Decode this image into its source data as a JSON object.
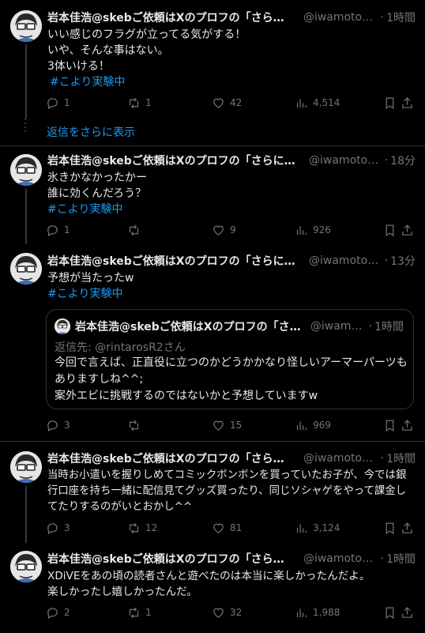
{
  "author": {
    "name": "岩本佳浩@skebご依頼はXのプロフの「さらに…",
    "name_long": "岩本佳浩@skebご依頼はXのプロフの「さらに表…",
    "handle": "@iwamoto_…",
    "handle_long": "@iwamoto_…",
    "dot": "·"
  },
  "tweets": [
    {
      "time": "1時間",
      "lines": [
        "いい感じのフラグが立ってる気がする！",
        "いや、そんな事はない。",
        "3体いける！"
      ],
      "hashtag": "#こより実験中",
      "stats": {
        "reply": "1",
        "retweet": "1",
        "like": "42",
        "views": "4,514"
      }
    },
    {
      "time": "18分",
      "lines": [
        "氷きかなかったかー",
        "誰に効くんだろう？"
      ],
      "hashtag": "#こより実験中",
      "stats": {
        "reply": "1",
        "retweet": "",
        "like": "9",
        "views": "926"
      }
    },
    {
      "time": "13分",
      "lines": [
        "予想が当たったw"
      ],
      "hashtag": "#こより実験中",
      "stats": {
        "reply": "3",
        "retweet": "",
        "like": "15",
        "views": "969"
      }
    },
    {
      "time": "1時間",
      "lines": [
        "当時お小遣いを握りしめてコミックボンボンを買っていたお子が、今では銀",
        "行口座を持ち一緒に配信見てグッズ買ったり、同じソシャゲをやって課金し",
        "てたりするのがいとおかし^^"
      ],
      "stats": {
        "reply": "3",
        "retweet": "12",
        "like": "81",
        "views": "3,124"
      }
    },
    {
      "time": "1時間",
      "lines": [
        "XDiVEをあの頃の読者さんと遊べたのは本当に楽しかったんだよ。",
        "楽しかったし嬉しかったんだ。"
      ],
      "stats": {
        "reply": "2",
        "retweet": "1",
        "like": "32",
        "views": "1,988"
      }
    }
  ],
  "show_more": "返信をさらに表示",
  "quote": {
    "name": "岩本佳浩@skebご依頼はXのプロフの「さら…",
    "handle": "@iwamo…",
    "time": "1時間",
    "reply_to_label": "返信先: ",
    "reply_to_user": "@rintarosR2さん",
    "lines": [
      "今回で言えば、正直役に立つのかどうかかなり怪しいアーマーパーツも",
      "ありますしね^^;",
      "案外エビに挑戦するのではないかと予想していますw"
    ]
  }
}
